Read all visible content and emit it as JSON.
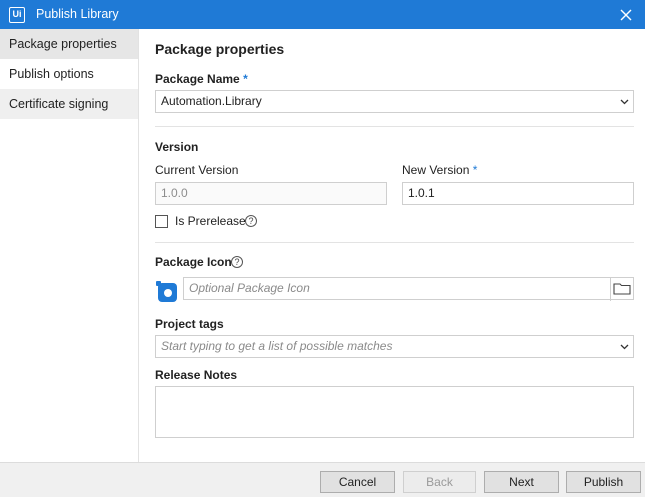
{
  "window": {
    "title": "Publish Library",
    "logo_text": "Ui"
  },
  "sidebar": {
    "items": [
      {
        "label": "Package properties"
      },
      {
        "label": "Publish options"
      },
      {
        "label": "Certificate signing"
      }
    ]
  },
  "main": {
    "section_title": "Package properties",
    "package_name": {
      "label": "Package Name",
      "required_mark": "*",
      "value": "Automation.Library"
    },
    "version": {
      "title": "Version",
      "current_label": "Current Version",
      "current_value": "1.0.0",
      "new_label": "New Version",
      "new_required_mark": "*",
      "new_value": "1.0.1",
      "prerelease_label": "Is Prerelease",
      "prerelease_checked": false
    },
    "package_icon": {
      "label": "Package Icon",
      "placeholder": "Optional Package Icon"
    },
    "project_tags": {
      "label": "Project tags",
      "placeholder": "Start typing to get a list of possible matches"
    },
    "release_notes": {
      "label": "Release Notes",
      "value": ""
    }
  },
  "footer": {
    "cancel": "Cancel",
    "back": "Back",
    "next": "Next",
    "publish": "Publish"
  },
  "colors": {
    "titlebar": "#1f7ad6",
    "accent": "#1f7ad6",
    "selected_item": "#e6e6e6"
  }
}
